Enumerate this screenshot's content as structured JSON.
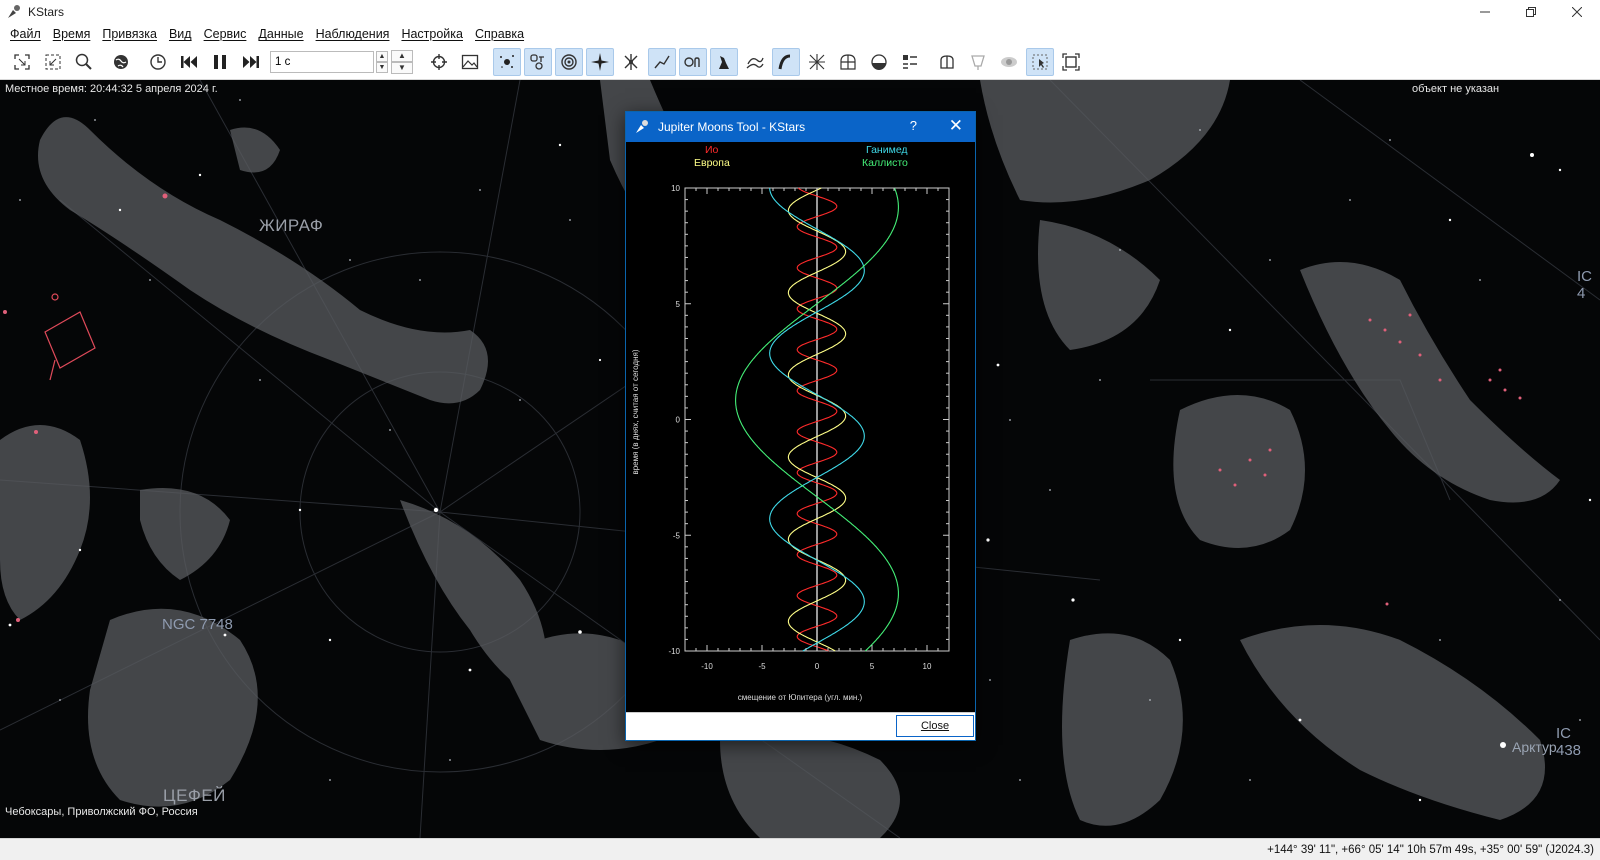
{
  "window": {
    "title": "KStars"
  },
  "menu": [
    "Файл",
    "Время",
    "Привязка",
    "Вид",
    "Сервис",
    "Данные",
    "Наблюдения",
    "Настройка",
    "Справка"
  ],
  "toolbar": {
    "time_step_value": "1 с"
  },
  "sky": {
    "local_time": "Местное время: 20:44:32   5 апреля 2024 г.",
    "focus_object": "объект не указан",
    "location": "Чебоксары, Приволжский ФО, Россия",
    "constellation_labels": {
      "giraffe": "ЖИРАФ",
      "cepheus": "ЦЕФЕЙ"
    },
    "dso_labels": {
      "ngc7748": "NGC 7748",
      "ic_top": "IC 4",
      "ic438": "IC 438"
    },
    "star_labels": {
      "arcturus": "Арктур"
    }
  },
  "status": {
    "coordinates": "+144° 39' 11\", +66° 05' 14\"  10h 57m 49s, +35° 00' 59\" (J2024.3)"
  },
  "dialog": {
    "title": "Jupiter Moons Tool - KStars",
    "help": "?",
    "close_button": "Close"
  },
  "chart_data": {
    "type": "line",
    "xlabel": "смещение от Юпитера (угл. мин.)",
    "ylabel": "время (в днях, считая от сегодня)",
    "xlim": [
      -12,
      12
    ],
    "ylim": [
      -10,
      10
    ],
    "xticks": [
      -10,
      -5,
      0,
      5,
      10
    ],
    "yticks": [
      10,
      5,
      0,
      -5,
      -10
    ],
    "series": [
      {
        "name": "Ио",
        "color": "#ff2b2b",
        "amplitude": 1.8,
        "period_days": 1.77,
        "phase": 0.3
      },
      {
        "name": "Европа",
        "color": "#ffff88",
        "amplitude": 2.6,
        "period_days": 3.55,
        "phase": 1.3
      },
      {
        "name": "Ганимед",
        "color": "#3fd9e8",
        "amplitude": 4.3,
        "period_days": 7.15,
        "phase": 2.2
      },
      {
        "name": "Каллисто",
        "color": "#44ee77",
        "amplitude": 7.4,
        "period_days": 16.69,
        "phase": 4.4
      }
    ]
  }
}
